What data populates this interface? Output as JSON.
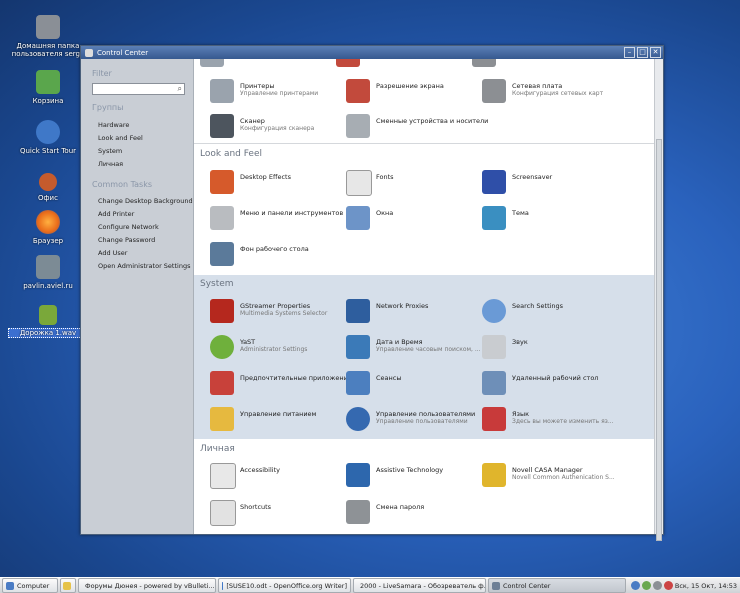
{
  "desktop": {
    "icons": [
      {
        "label1": "Домашняя папка",
        "label2": "пользователя serge",
        "color": "#8a8f96"
      },
      {
        "label1": "Корзина",
        "color": "#5aa64c"
      },
      {
        "label1": "Quick Start Tour",
        "color": "#3f78c8"
      },
      {
        "label1": "Офис",
        "color": "#c55b2d"
      },
      {
        "label1": "Браузер",
        "color": "#e96a19"
      },
      {
        "label1": "pavlin.aviel.ru",
        "color": "#7c8b95"
      },
      {
        "label1": "Дорожка 1.wav",
        "color": "#7aa83a"
      }
    ]
  },
  "window": {
    "title": "Control Center",
    "min": "–",
    "max": "□",
    "close": "✕"
  },
  "sidebar": {
    "filter_label": "Filter",
    "groups_label": "Группы",
    "groups": [
      "Hardware",
      "Look and Feel",
      "System",
      "Личная"
    ],
    "tasks_label": "Common Tasks",
    "tasks": [
      "Change Desktop Background",
      "Add Printer",
      "Configure Network",
      "Change Password",
      "Add User",
      "Open Administrator Settings"
    ]
  },
  "main": {
    "hardware_row1": [
      {
        "title": "Принтеры",
        "sub": "Управление принтерами",
        "color": "#9aa3ad"
      },
      {
        "title": "Разрешение экрана",
        "sub": "",
        "color": "#c24a3c"
      },
      {
        "title": "Сетевая плата",
        "sub": "Конфигурация сетевых карт",
        "color": "#8c8f93"
      }
    ],
    "hardware_row2": [
      {
        "title": "Сканер",
        "sub": "Конфигурация сканера",
        "color": "#4d555e"
      },
      {
        "title": "Сменные устройства и носители",
        "sub": "",
        "color": "#a7adb3"
      }
    ],
    "look_heading": "Look and Feel",
    "look_rows": [
      [
        {
          "title": "Desktop Effects",
          "sub": "",
          "color": "#d65a2b"
        },
        {
          "title": "Fonts",
          "sub": "",
          "color": "#e7e7e7"
        },
        {
          "title": "Screensaver",
          "sub": "",
          "color": "#2f4fa8"
        }
      ],
      [
        {
          "title": "Меню и панели инструментов",
          "sub": "",
          "color": "#b9bcc0"
        },
        {
          "title": "Окна",
          "sub": "",
          "color": "#6d94c8"
        },
        {
          "title": "Тема",
          "sub": "",
          "color": "#3a8fc1"
        }
      ],
      [
        {
          "title": "Фон рабочего стола",
          "sub": "",
          "color": "#5b7a9a"
        }
      ]
    ],
    "system_heading": "System",
    "system_rows": [
      [
        {
          "title": "GStreamer Properties",
          "sub": "Multimedia Systems Selector",
          "color": "#b5281e"
        },
        {
          "title": "Network Proxies",
          "sub": "",
          "color": "#2e5e9e"
        },
        {
          "title": "Search Settings",
          "sub": "",
          "color": "#6a9ad6"
        }
      ],
      [
        {
          "title": "YaST",
          "sub": "Administrator Settings",
          "color": "#6fb03c"
        },
        {
          "title": "Дата и Время",
          "sub": "Управление часовым поиском, ...",
          "color": "#3b7ab8"
        },
        {
          "title": "Звук",
          "sub": "",
          "color": "#c9ccd0"
        }
      ],
      [
        {
          "title": "Предпочтительные приложения",
          "sub": "",
          "color": "#c8413a"
        },
        {
          "title": "Сеансы",
          "sub": "",
          "color": "#4c7fbf"
        },
        {
          "title": "Удаленный рабочий стол",
          "sub": "",
          "color": "#6e8fb8"
        }
      ],
      [
        {
          "title": "Управление питанием",
          "sub": "",
          "color": "#e6b93f"
        },
        {
          "title": "Управление пользователями",
          "sub": "Управление пользователями",
          "color": "#3569b0"
        },
        {
          "title": "Язык",
          "sub": "Здесь вы можете изменить яз...",
          "color": "#c83a3a"
        }
      ]
    ],
    "personal_heading": "Личная",
    "personal_rows": [
      [
        {
          "title": "Accessibility",
          "sub": "",
          "color": "#e8e8e8"
        },
        {
          "title": "Assistive Technology",
          "sub": "",
          "color": "#2d67ad"
        },
        {
          "title": "Novell CASA Manager",
          "sub": "Novell Common Authenication S...",
          "color": "#e0b52c"
        }
      ],
      [
        {
          "title": "Shortcuts",
          "sub": "",
          "color": "#e2e2e2"
        },
        {
          "title": "Смена пароля",
          "sub": "",
          "color": "#8e9296"
        }
      ]
    ]
  },
  "taskbar": {
    "start": "Computer",
    "tasks": [
      {
        "label": "Форумы Дюнея - powered by vBulleti...",
        "color": "#e96a19"
      },
      {
        "label": "[SUSE10.odt - OpenOffice.org Writer]",
        "color": "#3f78c8"
      },
      {
        "label": "2000 - LiveSamara - Обозреватель ф...",
        "color": "#5a8fd0"
      },
      {
        "label": "Control Center",
        "color": "#6d7f96"
      }
    ],
    "clock": "Вск, 15 Окт, 14:53"
  }
}
